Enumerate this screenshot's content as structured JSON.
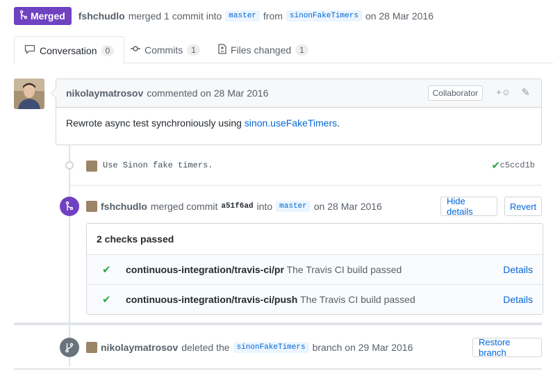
{
  "header": {
    "state_label": "Merged",
    "author": "fshchudlo",
    "action": "merged 1 commit into",
    "base_branch": "master",
    "from_word": "from",
    "head_branch": "sinonFakeTimers",
    "date": "on 28 Mar 2016",
    "state_color": "#6f42c1"
  },
  "tabs": [
    {
      "label": "Conversation",
      "count": "0",
      "icon": "comment-icon"
    },
    {
      "label": "Commits",
      "count": "1",
      "icon": "commit-icon"
    },
    {
      "label": "Files changed",
      "count": "1",
      "icon": "file-diff-icon"
    }
  ],
  "comment": {
    "author": "nikolaymatrosov",
    "action": "commented on 28 Mar 2016",
    "role": "Collaborator",
    "body_text": "Rewrote async test synchroniously using ",
    "body_link": "sinon.useFakeTimers",
    "body_end": "."
  },
  "commit": {
    "message": "Use Sinon fake timers.",
    "sha": "c5ccd1b"
  },
  "merge_event": {
    "author": "fshchudlo",
    "action": "merged commit",
    "sha": "a51f6ad",
    "into": "into",
    "branch": "master",
    "date": "on 28 Mar 2016",
    "hide_label": "Hide details",
    "revert_label": "Revert"
  },
  "checks": {
    "summary": "2 checks passed",
    "items": [
      {
        "context": "continuous-integration/travis-ci/pr",
        "description": "The Travis CI build passed",
        "link": "Details"
      },
      {
        "context": "continuous-integration/travis-ci/push",
        "description": "The Travis CI build passed",
        "link": "Details"
      }
    ]
  },
  "delete_event": {
    "author": "nikolaymatrosov",
    "action": "deleted the",
    "branch": "sinonFakeTimers",
    "date": "branch on 29 Mar 2016",
    "restore_label": "Restore branch"
  }
}
